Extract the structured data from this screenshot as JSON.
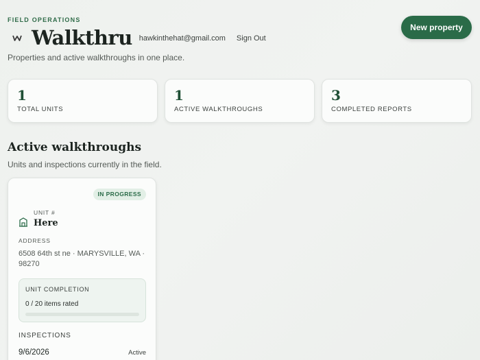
{
  "header": {
    "eyebrow": "FIELD OPERATIONS",
    "app_title": "Walkthru",
    "user_email": "hawkinthehat@gmail.com",
    "sign_out": "Sign Out",
    "subtitle": "Properties and active walkthroughs in one place.",
    "new_property_label": "New property",
    "logo_icon": "crown-logo-icon"
  },
  "stats": [
    {
      "value": "1",
      "label": "TOTAL UNITS"
    },
    {
      "value": "1",
      "label": "ACTIVE WALKTHROUGHS"
    },
    {
      "value": "3",
      "label": "COMPLETED REPORTS"
    }
  ],
  "section": {
    "title": "Active walkthroughs",
    "subtitle": "Units and inspections currently in the field."
  },
  "walkthrough_card": {
    "status_badge": "IN PROGRESS",
    "unit_label": "UNIT #",
    "unit_value": "Here",
    "unit_icon": "building-icon",
    "address_label": "ADDRESS",
    "address": "6508 64th st ne · MARYSVILLE, WA · 98270",
    "completion_label": "UNIT COMPLETION",
    "completion_text": "0 / 20 items rated",
    "completion_fraction": 0,
    "inspections_label": "INSPECTIONS",
    "inspections": [
      {
        "date": "9/6/2026",
        "status": "Active"
      }
    ]
  },
  "colors": {
    "accent": "#2a6b48",
    "badge_bg": "#e2efe6",
    "stat_number": "#1f4f35"
  }
}
